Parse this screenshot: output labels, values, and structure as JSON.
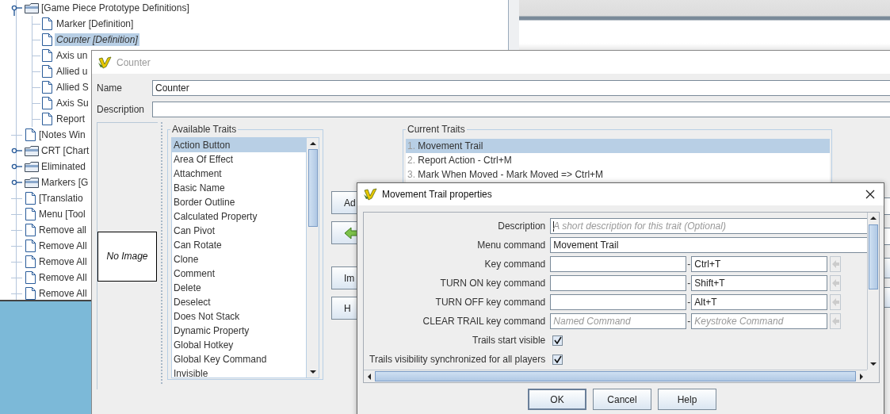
{
  "tree": {
    "items": [
      {
        "label": "[Game Piece Prototype Definitions]",
        "kind": "folder",
        "expanded": true,
        "selected": false,
        "children": [
          {
            "label": "Marker [Definition]",
            "kind": "file",
            "selected": false
          },
          {
            "label": "Counter [Definition]",
            "kind": "file",
            "selected": true
          },
          {
            "label": "Axis un",
            "kind": "file",
            "selected": false
          },
          {
            "label": "Allied u",
            "kind": "file",
            "selected": false
          },
          {
            "label": "Allied S",
            "kind": "file",
            "selected": false
          },
          {
            "label": "Axis Su",
            "kind": "file",
            "selected": false
          },
          {
            "label": "Report",
            "kind": "file",
            "selected": false
          }
        ]
      },
      {
        "label": "[Notes Win",
        "kind": "file",
        "selected": false
      },
      {
        "label": "CRT [Chart",
        "kind": "folder",
        "expanded": false,
        "selected": false
      },
      {
        "label": "Eliminated",
        "kind": "folder",
        "expanded": false,
        "selected": false
      },
      {
        "label": "Markers [G",
        "kind": "folder",
        "expanded": false,
        "selected": false
      },
      {
        "label": "[Translatio",
        "kind": "file",
        "selected": false
      },
      {
        "label": "Menu [Tool",
        "kind": "file",
        "selected": false
      },
      {
        "label": "Remove all",
        "kind": "file",
        "selected": false
      },
      {
        "label": "Remove All",
        "kind": "file",
        "selected": false
      },
      {
        "label": "Remove All",
        "kind": "file",
        "selected": false
      },
      {
        "label": "Remove All",
        "kind": "file",
        "selected": false
      },
      {
        "label": "Remove All",
        "kind": "file",
        "selected": false
      }
    ]
  },
  "piece_window": {
    "title": "Counter",
    "name_label": "Name",
    "name_value": "Counter",
    "description_label": "Description",
    "image_placeholder": "No Image",
    "available_traits": {
      "title": "Available Traits",
      "items": [
        {
          "label": "Action Button",
          "selected": true
        },
        {
          "label": "Area Of Effect",
          "selected": false
        },
        {
          "label": "Attachment",
          "selected": false
        },
        {
          "label": "Basic Name",
          "selected": false
        },
        {
          "label": "Border Outline",
          "selected": false
        },
        {
          "label": "Calculated Property",
          "selected": false
        },
        {
          "label": "Can Pivot",
          "selected": false
        },
        {
          "label": "Can Rotate",
          "selected": false
        },
        {
          "label": "Clone",
          "selected": false
        },
        {
          "label": "Comment",
          "selected": false
        },
        {
          "label": "Delete",
          "selected": false
        },
        {
          "label": "Deselect",
          "selected": false
        },
        {
          "label": "Does Not Stack",
          "selected": false
        },
        {
          "label": "Dynamic Property",
          "selected": false
        },
        {
          "label": "Global Hotkey",
          "selected": false
        },
        {
          "label": "Global Key Command",
          "selected": false
        },
        {
          "label": "Invisible",
          "selected": false
        }
      ]
    },
    "buttons": [
      {
        "kind": "text",
        "label": "Ad"
      },
      {
        "kind": "arrow"
      },
      {
        "kind": "text",
        "label": "Im"
      },
      {
        "kind": "text",
        "label": "H"
      }
    ],
    "current_traits": {
      "title": "Current Traits",
      "items": [
        {
          "number": "1.",
          "label": "Movement Trail",
          "selected": true
        },
        {
          "number": "2.",
          "label": "Report Action - Ctrl+M",
          "selected": false
        },
        {
          "number": "3.",
          "label": "Mark When Moved - Mark Moved => Ctrl+M",
          "selected": false
        }
      ]
    }
  },
  "trait_dialog": {
    "title": "Movement Trail properties",
    "rows": [
      {
        "kind": "text",
        "label": "Description",
        "placeholder": "A short description for this trait (Optional)",
        "focused": true
      },
      {
        "kind": "text",
        "label": "Menu command",
        "value": "Movement Trail",
        "focused": false
      },
      {
        "kind": "keys",
        "label": "Key command",
        "separator": "-",
        "keystroke": "Ctrl+T"
      },
      {
        "kind": "keys",
        "label": "TURN ON key command",
        "separator": "-",
        "keystroke": "Shift+T"
      },
      {
        "kind": "keys",
        "label": "TURN OFF key command",
        "separator": "-",
        "keystroke": "Alt+T"
      },
      {
        "kind": "keys",
        "label": "CLEAR TRAIL key command",
        "named_placeholder": "Named Command",
        "separator": "-",
        "keystroke_placeholder": "Keystroke Command"
      },
      {
        "kind": "checkbox",
        "label": "Trails start visible",
        "checked": true
      },
      {
        "kind": "checkbox",
        "label": "Trails visibility synchronized for all players",
        "checked": true
      }
    ],
    "buttons": [
      {
        "label": "OK",
        "default": true
      },
      {
        "label": "Cancel",
        "default": false
      },
      {
        "label": "Help",
        "default": false
      }
    ]
  }
}
